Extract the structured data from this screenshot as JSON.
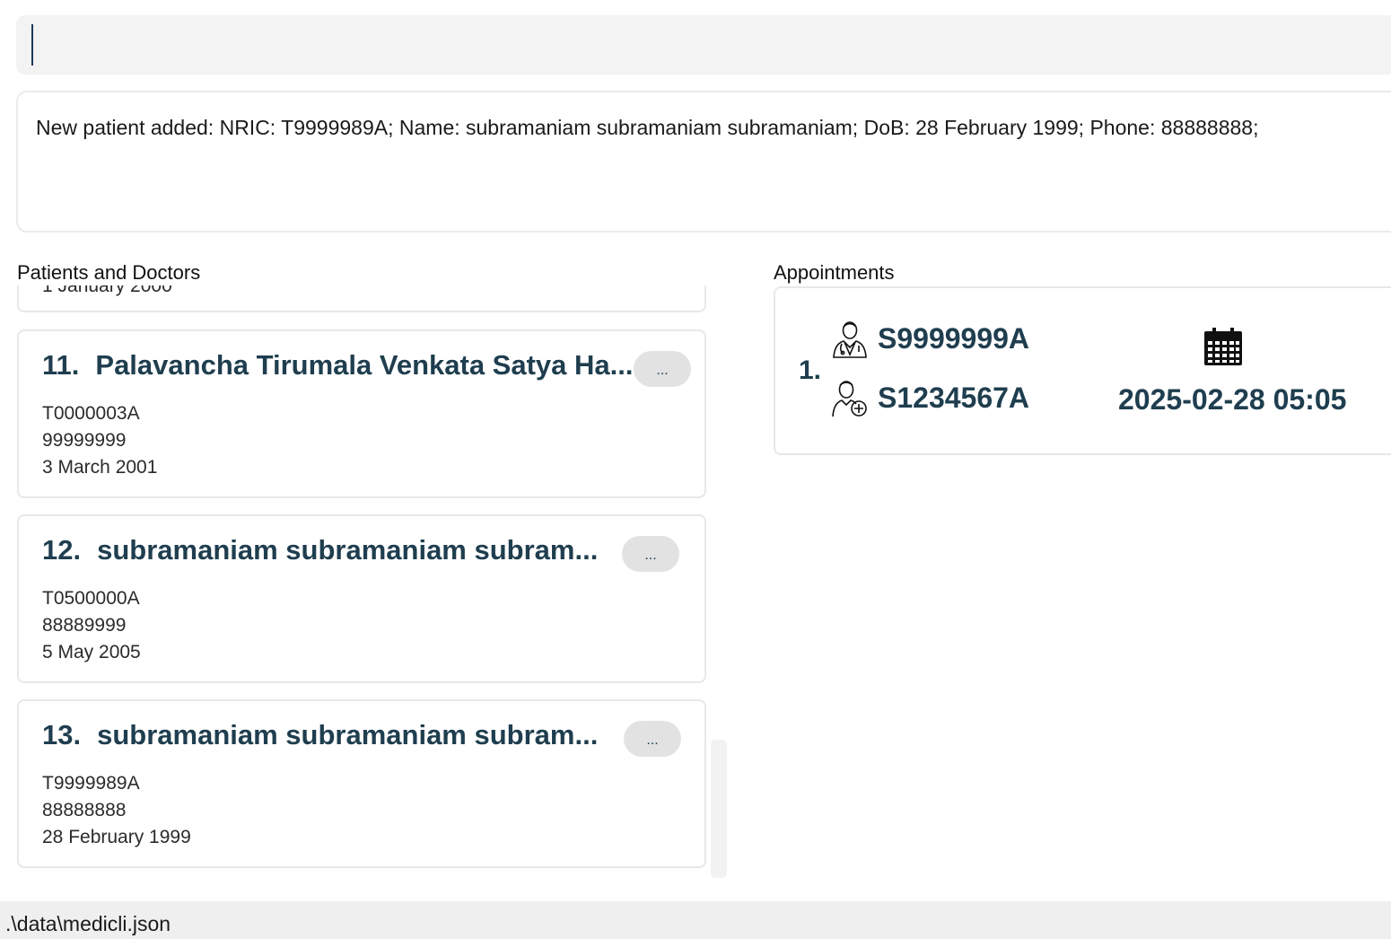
{
  "command": {
    "value": ""
  },
  "result": {
    "message": "New patient added: NRIC: T9999989A; Name: subramaniam subramaniam  subramaniam; DoB: 28 February 1999; Phone: 88888888;"
  },
  "patients_panel": {
    "label": "Patients and Doctors",
    "cutoff_text": "1 January 2000",
    "more_label": "...",
    "cards": [
      {
        "index": "11.",
        "name": "Palavancha Tirumala Venkata Satya Ha...",
        "nric": "T0000003A",
        "phone": "99999999",
        "dob": "3 March 2001"
      },
      {
        "index": "12.",
        "name": "subramaniam subramaniam subram...",
        "nric": "T0500000A",
        "phone": "88889999",
        "dob": "5 May 2005"
      },
      {
        "index": "13.",
        "name": "subramaniam subramaniam  subram...",
        "nric": "T9999989A",
        "phone": "88888888",
        "dob": "28 February 1999"
      }
    ]
  },
  "appointments_panel": {
    "label": "Appointments",
    "items": [
      {
        "index": "1.",
        "doctor_nric": "S9999999A",
        "patient_nric": "S1234567A",
        "datetime": "2025-02-28 05:05",
        "doctor_icon": "doctor-icon",
        "patient_icon": "patient-icon",
        "calendar_icon": "calendar-icon"
      }
    ]
  },
  "status_bar": {
    "path": ".\\data\\medicli.json"
  },
  "colors": {
    "accent": "#1f3e4f",
    "command_bg": "#f3f3f3",
    "status_bg": "#efefef",
    "card_border": "#e6e8eb"
  }
}
